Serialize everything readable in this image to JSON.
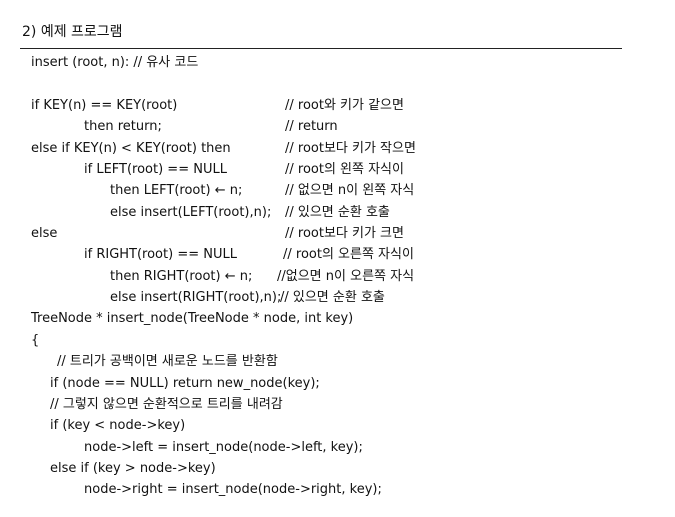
{
  "heading": "2) 예제 프로그램",
  "code": {
    "l1": "insert (root, n): // 유사 코드",
    "l2": "if KEY(n) == KEY(root)",
    "c2": "// root와 키가 같으면",
    "l3": "then return;",
    "c3": "// return",
    "l4": "else if KEY(n) < KEY(root) then",
    "c4": "// root보다 키가 작으면",
    "l5": "if LEFT(root) == NULL",
    "c5": "// root의 왼쪽 자식이",
    "l6": "then LEFT(root) ← n;",
    "c6": "// 없으면 n이 왼쪽 자식",
    "l7": "else insert(LEFT(root),n);",
    "c7": "// 있으면 순환 호출",
    "l8": "else",
    "c8": "// root보다 키가 크면",
    "l9": "if RIGHT(root) == NULL",
    "c9": "// root의 오른쪽 자식이",
    "l10": "then RIGHT(root) ← n;",
    "c10": "//없으면 n이 오른쪽 자식",
    "l11": "else insert(RIGHT(root),n);",
    "c11": "// 있으면 순환 호출",
    "l12": "TreeNode * insert_node(TreeNode * node, int key)",
    "l13": "{",
    "l14": "// 트리가 공백이면 새로운 노드를 반환함",
    "l15": "if (node == NULL) return new_node(key);",
    "l16": "// 그렇지 않으면 순환적으로 트리를 내려감",
    "l17": "if (key < node->key)",
    "l18": "node->left = insert_node(node->left, key);",
    "l19": "else if (key > node->key)",
    "l20": "node->right = insert_node(node->right, key);"
  }
}
